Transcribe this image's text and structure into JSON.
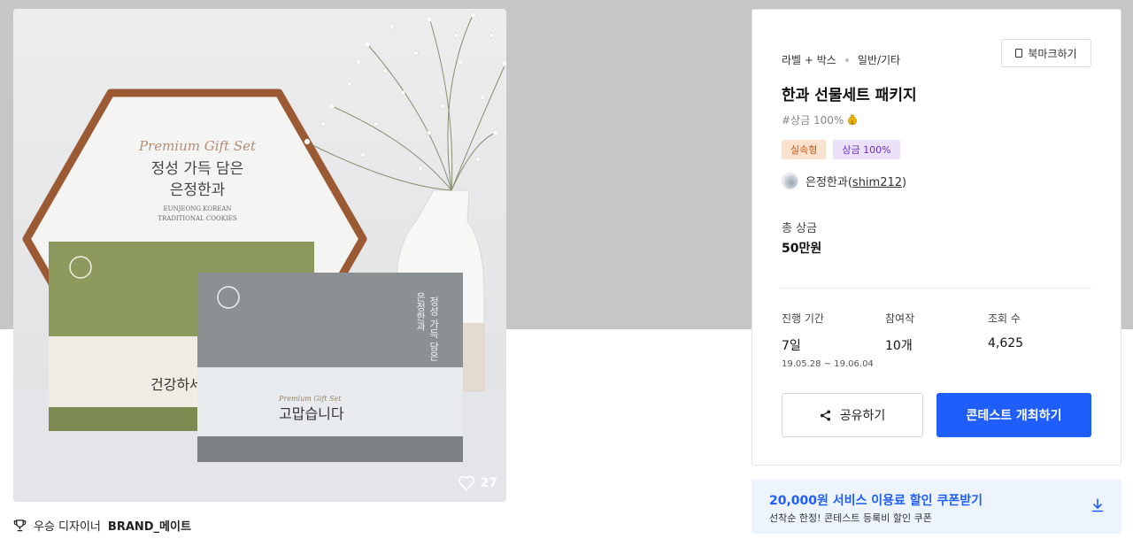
{
  "image": {
    "box_left_text": [
      "Premium Gift Set",
      "정성 가득 담은",
      "은정한과",
      "EUNJEONG KOREAN",
      "TRADITIONAL COOKIES"
    ],
    "box_green_text": "건강하세",
    "box_grey_text": [
      "고맙습니다",
      "Premium Gift Set",
      "정성 가득 담은",
      "은정한과"
    ],
    "like_count": "27"
  },
  "winner": {
    "prefix": "우승 디자이너",
    "name": "BRAND_메이트"
  },
  "card": {
    "bookmark_label": "북마크하기",
    "category_primary": "라벨 + 박스",
    "category_secondary": "일반/기타",
    "title": "한과 선물세트 패키지",
    "hashtag": "#상금 100%",
    "badges": [
      "실속형",
      "상금 100%"
    ],
    "host_name": "은정한과",
    "host_handle": "shim212",
    "total_prize_label": "총 상금",
    "total_prize_value": "50만원",
    "stats": {
      "duration_label": "진행 기간",
      "duration_value": "7일",
      "duration_range": "19.05.28 ~ 19.06.04",
      "participants_label": "참여작",
      "participants_value": "10개",
      "views_label": "조회 수",
      "views_value": "4,625"
    },
    "share_label": "공유하기",
    "host_contest_label": "콘테스트 개최하기"
  },
  "coupon": {
    "title": "20,000원 서비스 이용료 할인 쿠폰받기",
    "subtitle": "선착순 한정! 콘테스트 등록비 할인 쿠폰"
  },
  "colors": {
    "accent": "#1f5efa",
    "badge_practical_bg": "#fbe2cf",
    "badge_prize_bg": "#ece1fb",
    "coupon_bg": "#eef4fd"
  },
  "icons": [
    "heart-icon",
    "trophy-icon",
    "bookmark-icon",
    "coin-icon",
    "share-icon",
    "download-icon"
  ]
}
